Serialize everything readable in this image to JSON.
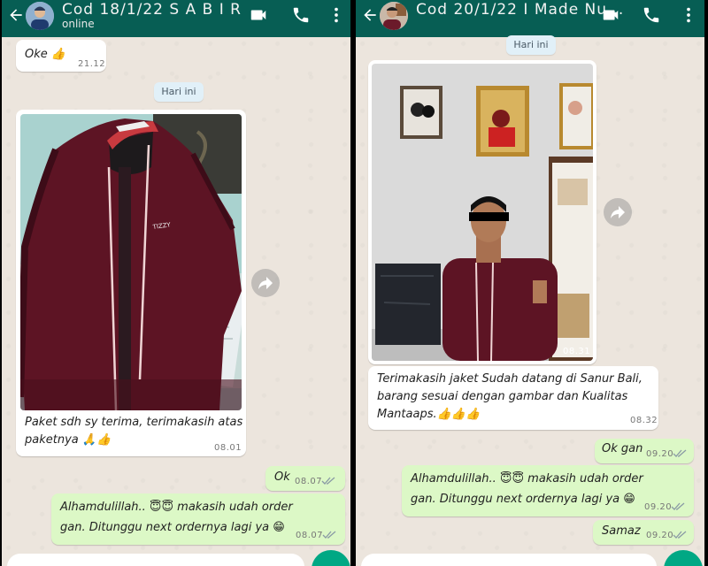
{
  "left_chat": {
    "header": {
      "title": "Cod 18/1/22 S A B I R",
      "status": "online"
    },
    "day_label": "Hari ini",
    "messages": {
      "oke": {
        "text": "Oke 👍",
        "time": "21.12"
      },
      "photo": {
        "caption_line1": "Paket sdh sy terima, terimakasih atas",
        "caption_line2": "paketnya 🙏👍",
        "time": "08.01",
        "jacket_brand": "TIZZY"
      },
      "ok": {
        "text": "Ok",
        "time": "08.07"
      },
      "reply": {
        "line1": "Alhamdulillah.. 😇😇 makasih udah order",
        "line2": "gan. Ditunggu next ordernya lagi ya 😁",
        "time": "08.07"
      }
    }
  },
  "right_chat": {
    "header": {
      "title": "Cod 20/1/22 I Made Nu..."
    },
    "day_label": "Hari ini",
    "messages": {
      "photo": {
        "time": "08.31"
      },
      "thanks": {
        "line1": "Terimakasih jaket Sudah datang di Sanur Bali,",
        "line2": "barang sesuai dengan gambar dan Kualitas",
        "line3": "Mantaaps.👍👍👍",
        "time": "08.32"
      },
      "okgan": {
        "text": "Ok gan",
        "time": "09.20"
      },
      "reply": {
        "line1": "Alhamdulillah.. 😇😇 makasih udah order",
        "line2": "gan. Ditunggu next ordernya lagi ya 😁",
        "time": "09.20"
      },
      "samaz": {
        "text": "Samaz",
        "time": "09.20"
      }
    }
  },
  "icons": [
    "back-arrow-icon",
    "video-call-icon",
    "phone-icon",
    "more-vert-icon",
    "forward-icon",
    "double-check-icon"
  ],
  "colors": {
    "header": "#075e54",
    "chat_bg": "#ece5dd",
    "incoming": "#ffffff",
    "outgoing": "#dcf8c6",
    "fab": "#00a884",
    "read_ticks": "#8a9aa5"
  }
}
